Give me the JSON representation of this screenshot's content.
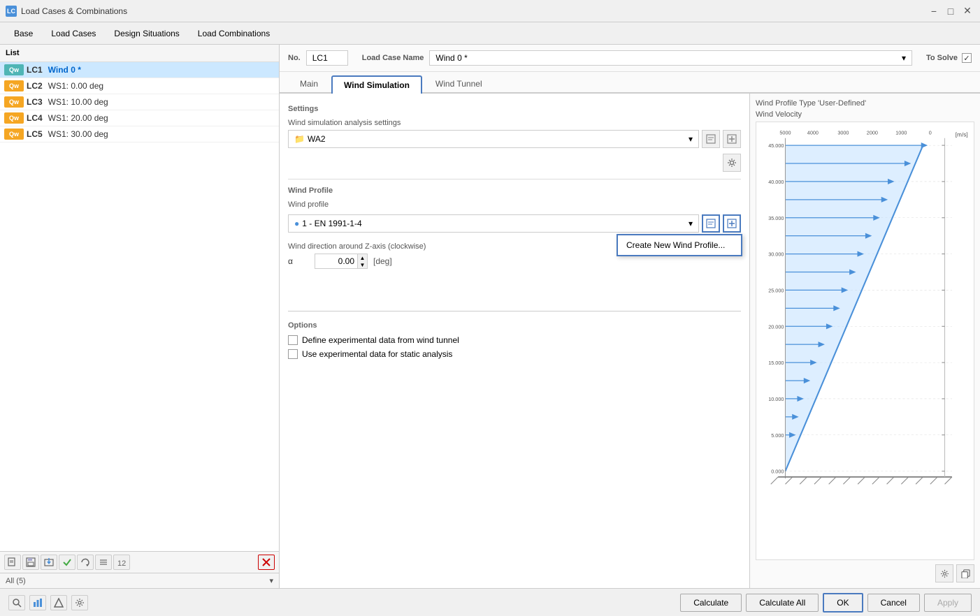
{
  "titleBar": {
    "icon": "LC",
    "title": "Load Cases & Combinations",
    "minimize": "−",
    "maximize": "□",
    "close": "✕"
  },
  "menuBar": {
    "items": [
      "Base",
      "Load Cases",
      "Design Situations",
      "Load Combinations"
    ]
  },
  "leftPanel": {
    "header": "List",
    "items": [
      {
        "badge": "Qw",
        "badgeColor": "teal",
        "id": "LC1",
        "name": "Wind 0 *",
        "selected": true
      },
      {
        "badge": "Qw",
        "badgeColor": "orange",
        "id": "LC2",
        "name": "WS1: 0.00 deg",
        "selected": false
      },
      {
        "badge": "Qw",
        "badgeColor": "orange",
        "id": "LC3",
        "name": "WS1: 10.00 deg",
        "selected": false
      },
      {
        "badge": "Qw",
        "badgeColor": "orange",
        "id": "LC4",
        "name": "WS1: 20.00 deg",
        "selected": false
      },
      {
        "badge": "Qw",
        "badgeColor": "orange",
        "id": "LC5",
        "name": "WS1: 30.00 deg",
        "selected": false
      }
    ],
    "toolbar": {
      "buttons": [
        "📁",
        "💾",
        "📤",
        "✔",
        "⟳",
        "🔄",
        "🔢"
      ]
    },
    "footer": "All (5)",
    "footerDropdown": "▾"
  },
  "infoRow": {
    "noLabel": "No.",
    "noValue": "LC1",
    "nameLabel": "Load Case Name",
    "nameValue": "Wind 0 *",
    "toSolveLabel": "To Solve",
    "toSolveChecked": true
  },
  "tabs": {
    "items": [
      "Main",
      "Wind Simulation",
      "Wind Tunnel"
    ],
    "active": "Wind Simulation"
  },
  "settings": {
    "sectionLabel": "Settings",
    "windSimLabel": "Wind simulation analysis settings",
    "windSimValue": "WA2",
    "windProfileLabel": "Wind Profile",
    "windProfileSubLabel": "Wind profile",
    "windProfileValue": "1 - EN 1991-1-4",
    "windDirectionLabel": "Wind direction around Z-axis (clockwise)",
    "alphaLabel": "α",
    "alphaValue": "0.00",
    "alphaUnit": "[deg]"
  },
  "contextMenu": {
    "visible": true,
    "items": [
      "Create New Wind Profile..."
    ]
  },
  "options": {
    "label": "Options",
    "checkbox1": "Define experimental data from wind tunnel",
    "checkbox2": "Use experimental data for static analysis"
  },
  "chartPanel": {
    "title1": "Wind Profile Type 'User-Defined'",
    "title2": "Wind Velocity",
    "yAxisLabel": "[m/s]",
    "yValues": [
      "45.000",
      "40.000",
      "35.000",
      "30.000",
      "25.000",
      "20.000",
      "15.000",
      "10.000",
      "5.000",
      "0.000"
    ],
    "xValues": [
      "5000",
      "4000",
      "3000",
      "2000",
      "1000",
      "0"
    ],
    "btns": [
      "⚙",
      "📋"
    ]
  },
  "bottomBar": {
    "leftBtns": [
      "🔍",
      "📊",
      "📐",
      "⚙"
    ],
    "buttons": [
      "Calculate",
      "Calculate All",
      "OK",
      "Cancel",
      "Apply"
    ]
  }
}
